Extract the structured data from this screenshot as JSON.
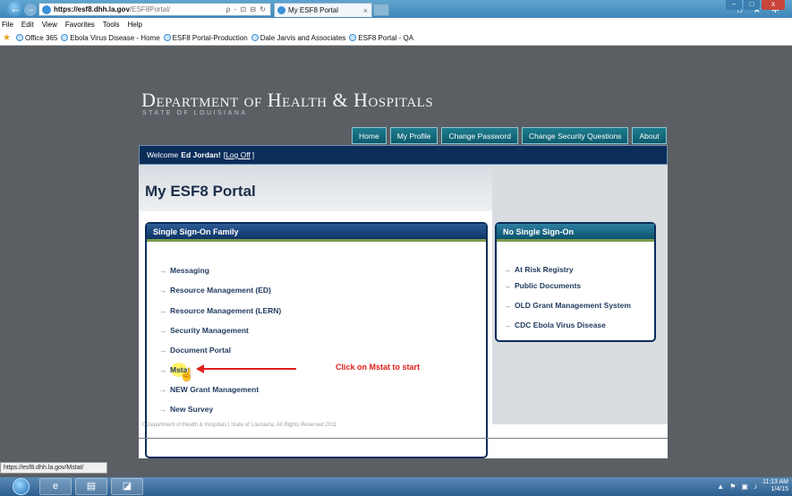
{
  "browser": {
    "address_host": "https://esf8.dhh.la.gov",
    "address_path": "/ESF8Portal/",
    "address_tools": "ρ - ⊡ ⊟ ↻",
    "tab_title": "My ESF8 Portal",
    "tab_close": "×",
    "corner_icons": "⌂ ★ ✲",
    "menu": [
      "File",
      "Edit",
      "View",
      "Favorites",
      "Tools",
      "Help"
    ],
    "favorites": [
      "Office 365",
      "Ebola Virus Disease - Home",
      "ESF8 Portal-Production",
      "Dale Jarvis and Associates",
      "ESF8 Portal - QA"
    ],
    "status_url": "https://esf8.dhh.la.gov/Mstat/"
  },
  "header": {
    "title": "Department of Health & Hospitals",
    "subtitle": "STATE OF LOUISIANA"
  },
  "topnav": [
    "Home",
    "My Profile",
    "Change Password",
    "Change Security Questions",
    "About"
  ],
  "welcome": {
    "prefix": "Welcome",
    "user": "Ed Jordan!",
    "open": "[",
    "logoff": "Log Off",
    "close": "]"
  },
  "page_title": "My ESF8 Portal",
  "sso": {
    "heading": "Single Sign-On Family",
    "items": [
      "Messaging",
      "Resource Management (ED)",
      "Resource Management (LERN)",
      "Security Management",
      "Document Portal",
      "Mstat",
      "NEW Grant Management",
      "New Survey"
    ]
  },
  "no_sso": {
    "heading": "No Single Sign-On",
    "items": [
      "At Risk Registry",
      "Public Documents",
      "OLD Grant Management System",
      "CDC Ebola Virus Disease"
    ]
  },
  "annotation": "Click on Mstat to start",
  "footer": "© Department of Health & Hospitals | State of Louisiana, All Rights Reserved 2011",
  "taskbar": {
    "time": "11:13 AM",
    "date": "1/4/15"
  },
  "colors": {
    "nav_teal": "#0c5b6d",
    "welcome_navy": "#0b2d5a",
    "annotation_red": "#e0201c"
  }
}
